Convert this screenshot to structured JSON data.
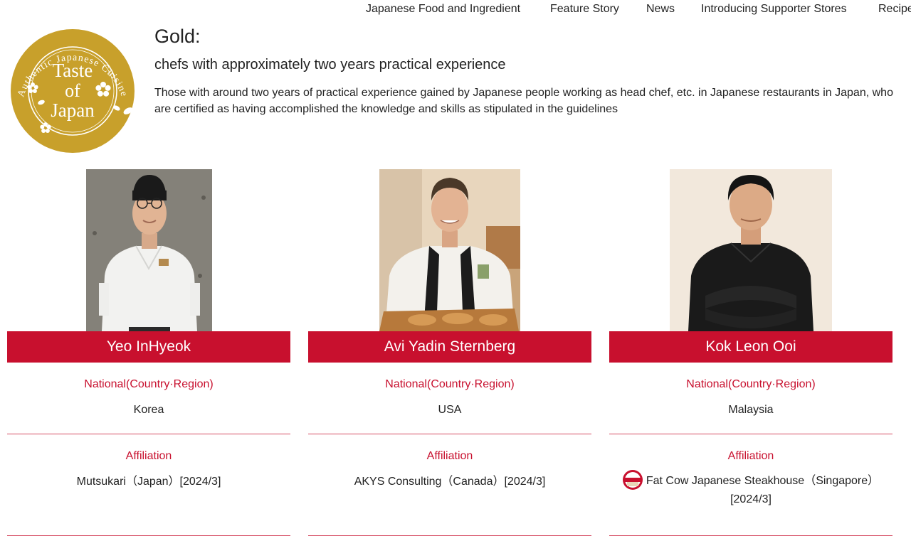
{
  "nav": {
    "items": [
      "Japanese Food and Ingredient",
      "Feature Story",
      "News",
      "Introducing Supporter Stores",
      "Recipe"
    ]
  },
  "logo": {
    "arc_text": "Authentic Japanese Cuisine",
    "line1": "Taste",
    "line2": "of",
    "line3": "Japan",
    "color": "#c8a02b"
  },
  "rank": {
    "title": "Gold:",
    "subtitle": "chefs with approximately two years practical experience",
    "description": "Those with around two years of practical experience gained by Japanese people working as head chef, etc. in Japanese restaurants in Japan, who are certified as having accomplished the knowledge and skills as stipulated in the guidelines"
  },
  "labels": {
    "national": "National(Country·Region)",
    "affiliation": "Affiliation"
  },
  "chefs": [
    {
      "name": "Yeo InHyeok",
      "country": "Korea",
      "affiliation": "Mutsukari（Japan）[2024/3]",
      "has_icon": false
    },
    {
      "name": "Avi Yadin Sternberg",
      "country": "USA",
      "affiliation": "AKYS Consulting（Canada）[2024/3]",
      "has_icon": false
    },
    {
      "name": "Kok Leon Ooi",
      "country": "Malaysia",
      "affiliation": "Fat Cow Japanese Steakhouse（Singapore）[2024/3]",
      "has_icon": true
    }
  ],
  "colors": {
    "accent": "#c8102e",
    "logo_gold": "#c8a02b"
  }
}
